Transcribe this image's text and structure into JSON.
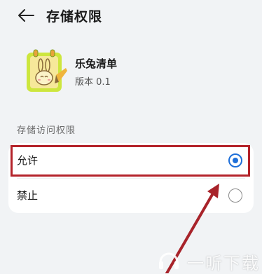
{
  "header": {
    "title": "存储权限",
    "back_icon": "arrow-left-icon"
  },
  "app": {
    "name": "乐兔清单",
    "version": "版本 0.1",
    "icon": "rabbit-notepad-icon"
  },
  "section": {
    "title": "存储访问权限"
  },
  "options": [
    {
      "label": "允许",
      "selected": true
    },
    {
      "label": "禁止",
      "selected": false
    }
  ],
  "colors": {
    "accent": "#1e6fd9",
    "highlight": "#b4232a",
    "background": "#f1f3f5"
  },
  "watermark": {
    "text": "一听下载",
    "icon": "headphone-logo-icon"
  }
}
